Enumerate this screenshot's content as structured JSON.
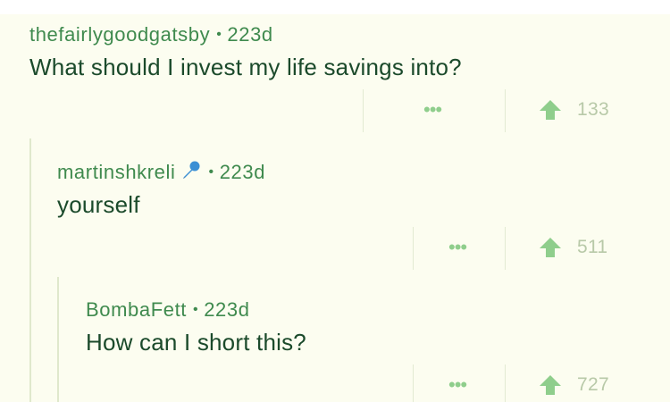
{
  "comments": [
    {
      "username": "thefairlygoodgatsby",
      "separator": "•",
      "age": "223d",
      "text": "What should I invest my life savings into?",
      "more_label": "•••",
      "upvotes": "133"
    },
    {
      "username": "martinshkreli",
      "badge_icon": "microphone-icon",
      "separator": "•",
      "age": "223d",
      "text": "yourself",
      "more_label": "•••",
      "upvotes": "511"
    },
    {
      "username": "BombaFett",
      "separator": "•",
      "age": "223d",
      "text": "How can I short this?",
      "more_label": "•••",
      "upvotes": "727"
    }
  ],
  "colors": {
    "background": "#fcfdf0",
    "username": "#3f8a4e",
    "text": "#1b4a2b",
    "upvote_arrow": "#8fce8c",
    "count": "#b8c9a8"
  }
}
